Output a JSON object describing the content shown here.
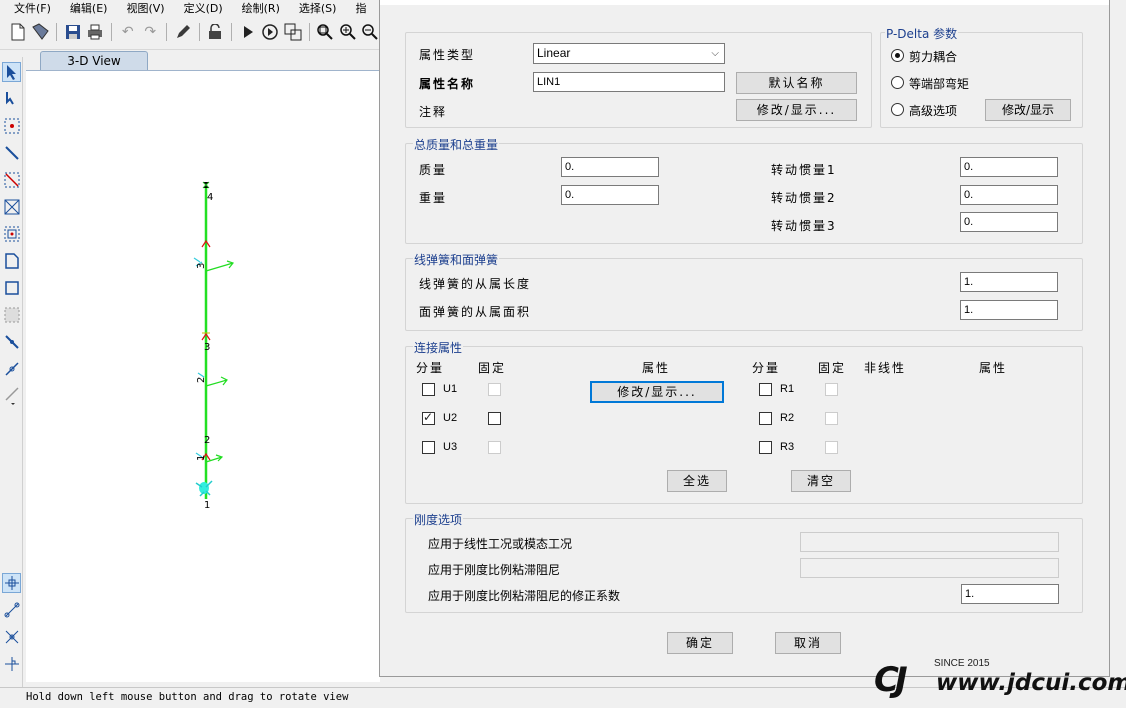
{
  "menu": [
    "文件(F)",
    "编辑(E)",
    "视图(V)",
    "定义(D)",
    "绘制(R)",
    "选择(S)",
    "指"
  ],
  "view": {
    "tab_label": "3-D View",
    "node_labels": [
      "4",
      "3",
      "2",
      "1"
    ],
    "axis_labels": [
      "3",
      "2",
      "1"
    ]
  },
  "status": {
    "text": "Hold down left mouse button and drag to rotate view"
  },
  "dialog": {
    "prop_type_label": "属性类型",
    "prop_type_value": "Linear",
    "prop_name_label": "属性名称",
    "prop_name_value": "LIN1",
    "default_name_button": "默认名称",
    "notes_label": "注释",
    "modify_show_button": "修改/显示...",
    "pdelta": {
      "title": "P-Delta 参数",
      "options": [
        "剪力耦合",
        "等端部弯矩",
        "高级选项"
      ],
      "selected": "剪力耦合",
      "modify_button": "修改/显示"
    },
    "mass": {
      "title": "总质量和总重量",
      "mass_label": "质量",
      "mass_value": "0.",
      "weight_label": "重量",
      "weight_value": "0.",
      "rot1_label": "转动惯量1",
      "rot1_value": "0.",
      "rot2_label": "转动惯量2",
      "rot2_value": "0.",
      "rot3_label": "转动惯量3",
      "rot3_value": "0."
    },
    "springs": {
      "title": "线弹簧和面弹簧",
      "line_label": "线弹簧的从属长度",
      "line_value": "1.",
      "area_label": "面弹簧的从属面积",
      "area_value": "1."
    },
    "link": {
      "title": "连接属性",
      "hdr_dir_left": "分量",
      "hdr_fixed_left": "固定",
      "hdr_props_left": "属性",
      "hdr_dir_right": "分量",
      "hdr_fixed_right": "固定",
      "hdr_nonlinear": "非线性",
      "hdr_props_right": "属性",
      "dirs_left": [
        {
          "label": "U1",
          "checked": false
        },
        {
          "label": "U2",
          "checked": true
        },
        {
          "label": "U3",
          "checked": false
        }
      ],
      "dirs_right": [
        {
          "label": "R1",
          "checked": false
        },
        {
          "label": "R2",
          "checked": false
        },
        {
          "label": "R3",
          "checked": false
        }
      ],
      "modify_button": "修改/显示...",
      "select_all_button": "全选",
      "clear_button": "清空"
    },
    "stiffness": {
      "title": "刚度选项",
      "opt1_label": "应用于线性工况或模态工况",
      "opt2_label": "应用于刚度比例粘滞阻尼",
      "opt3_label": "应用于刚度比例粘滞阻尼的修正系数",
      "opt3_value": "1."
    },
    "ok_button": "确定",
    "cancel_button": "取消"
  },
  "watermark": {
    "since": "SINCE 2015",
    "url": "www.jdcui.com"
  }
}
